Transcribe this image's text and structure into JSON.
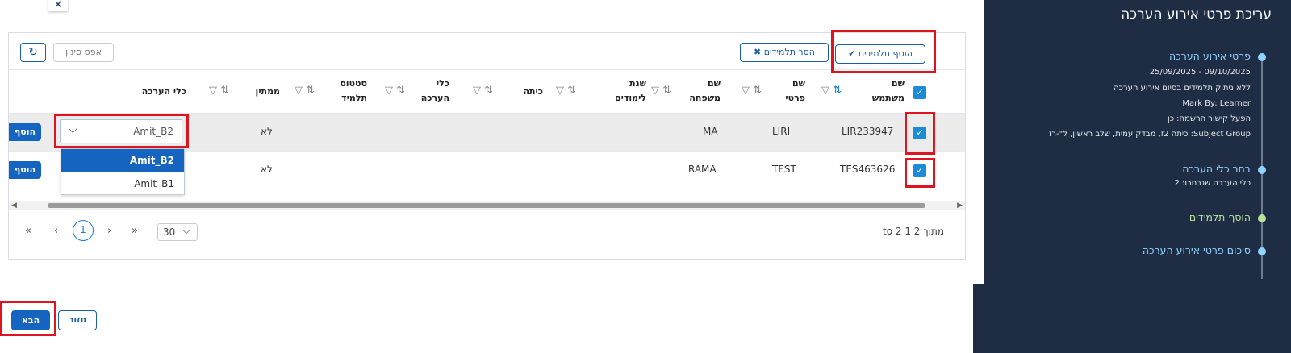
{
  "sidebar": {
    "title": "עריכת פרטי אירוע הערכה",
    "steps": [
      {
        "title": "פרטי אירוע הערכה",
        "lines": [
          "09/10/2025 - 25/09/2025",
          "ללא ניתוק תלמידים בסיום אירוע הערכה",
          "Mark By: Learner",
          "הפעל קישור הרשמה: כן",
          "Subject Group: כיתה 2ז, מבדק עמית, שלב ראשון, ל\"-רז"
        ]
      },
      {
        "title": "בחר כלי הערכה",
        "lines": [
          "כלי הערכה שנבחרו: 2"
        ]
      },
      {
        "title": "הוסף תלמידים",
        "lines": []
      },
      {
        "title": "סיכום פרטי אירוע הערכה",
        "lines": []
      }
    ],
    "colors": {
      "bg": "#1e2d44",
      "done": "#8fd3ff",
      "current": "#b6e39a"
    }
  },
  "close_label": "×",
  "toolbar": {
    "add_students": "הוסף תלמידים",
    "remove_students": "הסר תלמידים",
    "reset_filter": "אפס סינון",
    "refresh_icon": "↻"
  },
  "table": {
    "headers": {
      "username": "שם משתמש",
      "first_name": "שם פרטי",
      "last_name": "שם משפחה",
      "school_year": "שנת לימודים",
      "class": "כיתה",
      "assessment_tool": "כלי הערכה",
      "student_status": "סטטוס תלמיד",
      "waiting": "ממתין",
      "tools_col": "כלי הערכה"
    },
    "rows": [
      {
        "username": "LIR233947",
        "first_name": "LIRI",
        "last_name": "MA",
        "waiting": "לא",
        "add": "הוסף"
      },
      {
        "username": "TES463626",
        "first_name": "TEST",
        "last_name": "RAMA",
        "waiting": "לא",
        "add": "הוסף"
      }
    ],
    "dropdown": {
      "selected": "Amit_B2",
      "options": [
        "Amit_B2",
        "Amit_B1"
      ]
    }
  },
  "pager": {
    "first": "«",
    "prev": "‹",
    "current": "1",
    "next": "›",
    "last": "»",
    "page_size": "30",
    "info": "מתוך 2 1 to 2"
  },
  "footer": {
    "back": "חזור",
    "next": "הבא"
  }
}
